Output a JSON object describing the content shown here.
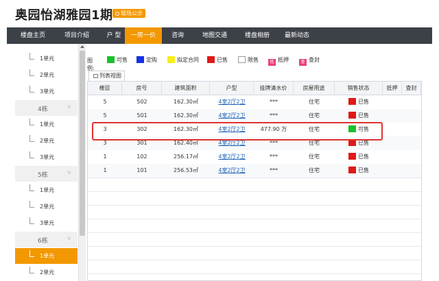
{
  "header": {
    "title": "奥园怡湖雅园1期",
    "badge": "现场公示"
  },
  "nav": {
    "items": [
      {
        "label": "楼盘主页"
      },
      {
        "label": "项目介绍"
      },
      {
        "label": "户 型"
      },
      {
        "label": "一房一价",
        "active": true
      },
      {
        "label": "咨询"
      },
      {
        "label": "地图交通"
      },
      {
        "label": "楼盘相册"
      },
      {
        "label": "最新动态"
      }
    ]
  },
  "sidebar": {
    "items": [
      {
        "type": "unit",
        "label": "1单元"
      },
      {
        "type": "unit",
        "label": "2单元"
      },
      {
        "type": "unit",
        "label": "3单元"
      },
      {
        "type": "building",
        "label": "4栋"
      },
      {
        "type": "unit",
        "label": "1单元"
      },
      {
        "type": "unit",
        "label": "2单元"
      },
      {
        "type": "unit",
        "label": "3单元"
      },
      {
        "type": "building",
        "label": "5栋"
      },
      {
        "type": "unit",
        "label": "1单元"
      },
      {
        "type": "unit",
        "label": "2单元"
      },
      {
        "type": "unit",
        "label": "3单元"
      },
      {
        "type": "building",
        "label": "6栋"
      },
      {
        "type": "unit",
        "label": "1单元",
        "active": true
      },
      {
        "type": "unit",
        "label": "2单元"
      }
    ]
  },
  "legend": {
    "label": "图例:",
    "items": [
      {
        "label": "可售",
        "color": "#19c12a",
        "kind": "swatch"
      },
      {
        "label": "定购",
        "color": "#1432e8",
        "kind": "swatch"
      },
      {
        "label": "拟定合同",
        "color": "#f5ee16",
        "kind": "swatch"
      },
      {
        "label": "已售",
        "color": "#e01818",
        "kind": "swatch"
      },
      {
        "label": "限售",
        "color": "#ffffff",
        "kind": "empty"
      },
      {
        "label": "抵押",
        "glyph": "抵",
        "kind": "box"
      },
      {
        "label": "查封",
        "glyph": "查",
        "kind": "box"
      }
    ]
  },
  "tab": {
    "label": "列表视图"
  },
  "table": {
    "columns": [
      "楼层",
      "房号",
      "建筑面积",
      "户型",
      "挂牌清水价",
      "房屋用途",
      "销售状态",
      "抵押",
      "查封"
    ],
    "rows": [
      {
        "floor": "5",
        "room": "502",
        "area": "162.30㎡",
        "layout": "4室2厅2卫",
        "price": "***",
        "use": "住宅",
        "status": "已售",
        "status_color": "#e01818"
      },
      {
        "floor": "5",
        "room": "501",
        "area": "162.30㎡",
        "layout": "4室2厅2卫",
        "price": "***",
        "use": "住宅",
        "status": "已售",
        "status_color": "#e01818"
      },
      {
        "floor": "3",
        "room": "302",
        "area": "162.30㎡",
        "layout": "4室2厅2卫",
        "price": "477.90 万",
        "use": "住宅",
        "status": "可售",
        "status_color": "#19c12a"
      },
      {
        "floor": "3",
        "room": "301",
        "area": "162.40㎡",
        "layout": "4室2厅2卫",
        "price": "***",
        "use": "住宅",
        "status": "已售",
        "status_color": "#e01818"
      },
      {
        "floor": "1",
        "room": "102",
        "area": "256.17㎡",
        "layout": "4室2厅2卫",
        "price": "***",
        "use": "住宅",
        "status": "已售",
        "status_color": "#e01818"
      },
      {
        "floor": "1",
        "room": "101",
        "area": "256.53㎡",
        "layout": "4室2厅2卫",
        "price": "***",
        "use": "住宅",
        "status": "已售",
        "status_color": "#e01818"
      }
    ]
  }
}
